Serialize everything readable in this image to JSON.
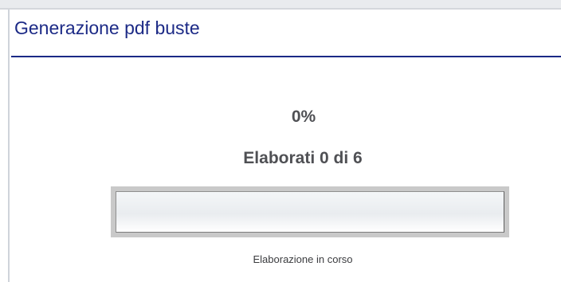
{
  "panel": {
    "title": "Generazione pdf buste"
  },
  "progress": {
    "percent_label": "0%",
    "count_label": "Elaborati 0 di 6",
    "processed": 0,
    "total": 6,
    "fraction": 0,
    "status_label": "Elaborazione in corso"
  },
  "colors": {
    "title": "#1c2a86",
    "underline": "#1b2a86",
    "label_text": "#4f5054",
    "track": "#c9c9c9"
  }
}
